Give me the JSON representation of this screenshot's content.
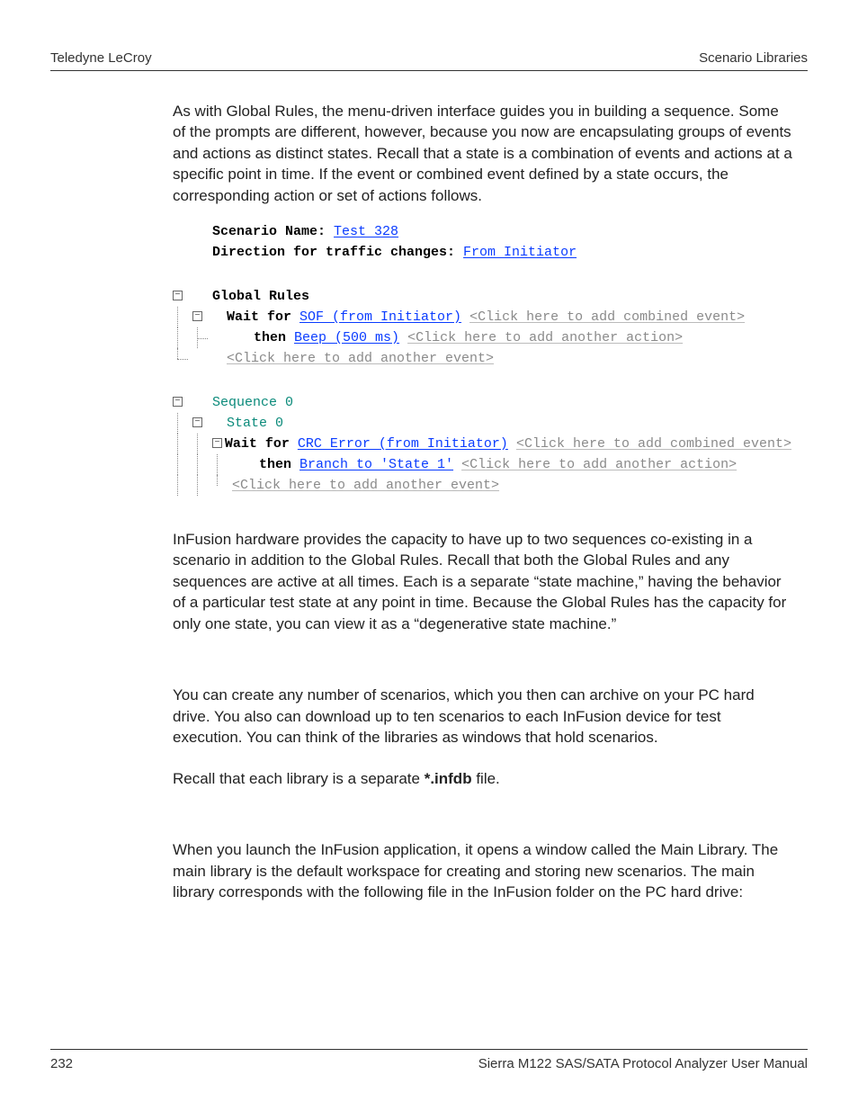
{
  "header": {
    "left": "Teledyne LeCroy",
    "right": "Scenario Libraries"
  },
  "footer": {
    "page": "232",
    "title": "Sierra M122 SAS/SATA Protocol Analyzer User Manual"
  },
  "para1": "As with Global Rules, the menu-driven interface guides you in building a sequence. Some of the prompts are different, however, because you now are encapsulating groups of events and actions as distinct states. Recall that a state is a combination of events and actions at a specific point in time. If the event or combined event defined by a state occurs, the corresponding action or set of actions follows.",
  "para2": "InFusion hardware provides the capacity to have up to two sequences co-existing in a scenario in addition to the Global Rules. Recall that both the Global Rules and any sequences are active at all times. Each is a separate “state machine,” having the behavior of a particular test state at any point in time. Because the Global Rules has the capacity for only one state, you can view it as a “degenerative state machine.”",
  "para3": "You can create any number of scenarios, which you then can archive on your PC hard drive. You also can download up to ten scenarios to each InFusion device for test execution. You can think of the libraries as windows that hold scenarios.",
  "para4a": "Recall that each library is a separate ",
  "para4b": "*.infdb",
  "para4c": " file.",
  "para5": "When you launch the InFusion application, it opens a window called the Main Library. The main library is the default workspace for creating and storing new scenarios. The main library corresponds with the following file in the InFusion folder on the PC hard drive:",
  "fig": {
    "scenario_label": "Scenario Name: ",
    "scenario_value": "Test 328",
    "direction_label": "Direction for traffic changes: ",
    "direction_value": "From Initiator",
    "global_rules": "Global Rules",
    "gr_wait": "Wait for ",
    "gr_sof": "SOF (from Initiator)",
    "gr_hint_combined": "<Click here to add combined event>",
    "gr_then": "then ",
    "gr_beep": "Beep (500 ms)",
    "gr_hint_action": "<Click here to add another action>",
    "gr_hint_event": "<Click here to add another event>",
    "seq0": "Sequence 0",
    "state0": "State 0",
    "s0_wait": "Wait for ",
    "s0_crc": "CRC Error (from Initiator)",
    "s0_hint_combined": "<Click here to add combined event>",
    "s0_then": "then ",
    "s0_branch": "Branch to 'State 1'",
    "s0_hint_action": "<Click here to add another action>",
    "s0_hint_event": "<Click here to add another event>"
  }
}
